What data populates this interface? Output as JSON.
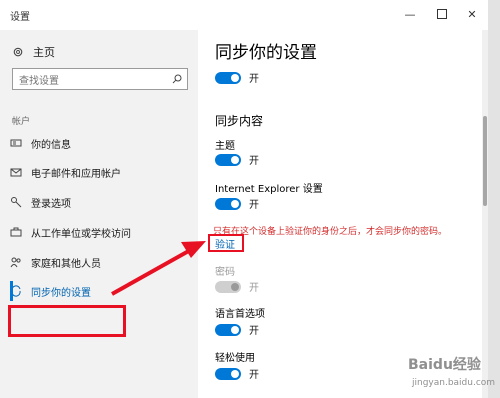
{
  "window": {
    "title": "设置",
    "min_glyph": "—",
    "close_glyph": "✕"
  },
  "sidebar": {
    "home_label": "主页",
    "search_placeholder": "查找设置",
    "section_title": "帐户",
    "items": [
      {
        "label": "你的信息",
        "icon": "person-card-icon"
      },
      {
        "label": "电子邮件和应用帐户",
        "icon": "mail-icon"
      },
      {
        "label": "登录选项",
        "icon": "key-icon"
      },
      {
        "label": "从工作单位或学校访问",
        "icon": "briefcase-icon"
      },
      {
        "label": "家庭和其他人员",
        "icon": "people-icon"
      },
      {
        "label": "同步你的设置",
        "icon": "sync-icon",
        "active": true
      }
    ]
  },
  "main": {
    "title": "同步你的设置",
    "sync_toggle_label": "开",
    "sync_content_title": "同步内容",
    "settings": [
      {
        "label": "主题",
        "state": "开",
        "enabled": true
      },
      {
        "label": "Internet Explorer 设置",
        "state": "开",
        "enabled": true
      },
      {
        "label": "密码",
        "state": "开",
        "enabled": false
      },
      {
        "label": "语言首选项",
        "state": "开",
        "enabled": true
      },
      {
        "label": "轻松使用",
        "state": "开",
        "enabled": true
      }
    ],
    "warning": "只有在这个设备上验证你的身份之后，才会同步你的密码。",
    "verify_link": "验证"
  },
  "watermark": {
    "brand": "Baidu经验",
    "url": "jingyan.baidu.com"
  },
  "colors": {
    "accent": "#0078d7",
    "warning": "#d32f2f",
    "annotation": "#e81123"
  }
}
